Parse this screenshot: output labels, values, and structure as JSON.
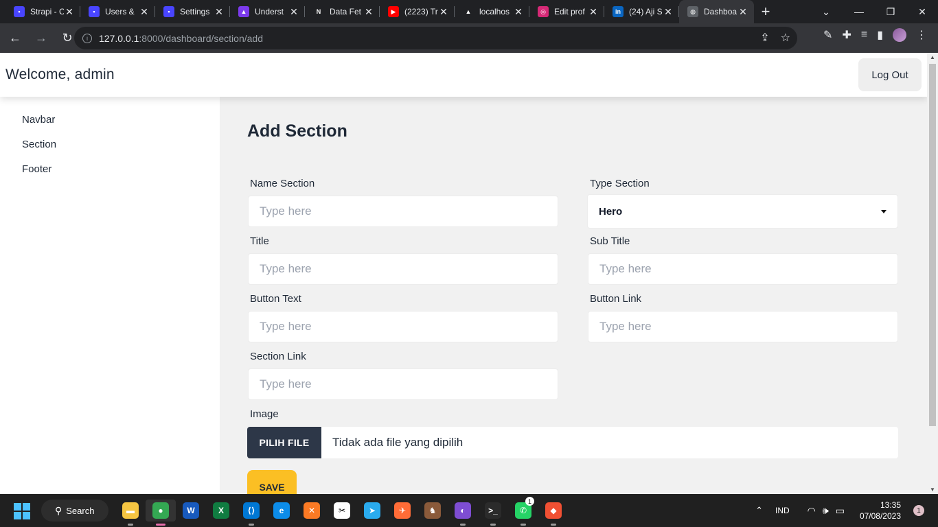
{
  "browser": {
    "tabs": [
      {
        "title": "Strapi - C",
        "favicon_color": "#4945ff",
        "favicon_glyph": "▪"
      },
      {
        "title": "Users &",
        "favicon_color": "#4945ff",
        "favicon_glyph": "▪"
      },
      {
        "title": "Settings",
        "favicon_color": "#4945ff",
        "favicon_glyph": "▪"
      },
      {
        "title": "Underst",
        "favicon_color": "#7c3aed",
        "favicon_glyph": "▲"
      },
      {
        "title": "Data Fet",
        "favicon_color": "#202124",
        "favicon_glyph": "N"
      },
      {
        "title": "(2223) Tr",
        "favicon_color": "#ff0000",
        "favicon_glyph": "▶"
      },
      {
        "title": "localhos",
        "favicon_color": "#202124",
        "favicon_glyph": "▲"
      },
      {
        "title": "Edit prof",
        "favicon_color": "#d62976",
        "favicon_glyph": "◎"
      },
      {
        "title": "(24) Aji S",
        "favicon_color": "#0a66c2",
        "favicon_glyph": "in"
      },
      {
        "title": "Dashboa",
        "favicon_color": "#5f6368",
        "favicon_glyph": "◍"
      }
    ],
    "new_tab_label": "+",
    "url_host": "127.0.0.1",
    "url_path": ":8000/dashboard/section/add"
  },
  "header": {
    "welcome": "Welcome, admin",
    "logout_label": "Log Out"
  },
  "sidebar": {
    "items": [
      {
        "label": "Navbar"
      },
      {
        "label": "Section"
      },
      {
        "label": "Footer"
      }
    ]
  },
  "form": {
    "title": "Add Section",
    "name_section": {
      "label": "Name Section",
      "placeholder": "Type here"
    },
    "type_section": {
      "label": "Type Section",
      "value": "Hero"
    },
    "title_field": {
      "label": "Title",
      "placeholder": "Type here"
    },
    "sub_title": {
      "label": "Sub Title",
      "placeholder": "Type here"
    },
    "button_text": {
      "label": "Button Text",
      "placeholder": "Type here"
    },
    "button_link": {
      "label": "Button Link",
      "placeholder": "Type here"
    },
    "section_link": {
      "label": "Section Link",
      "placeholder": "Type here"
    },
    "image": {
      "label": "Image",
      "button_label": "PILIH FILE",
      "file_status": "Tidak ada file yang dipilih"
    },
    "save_label": "SAVE"
  },
  "taskbar": {
    "search_label": "Search",
    "apps": [
      {
        "name": "file-explorer",
        "color": "#f5c542",
        "glyph": "▬"
      },
      {
        "name": "chrome",
        "color": "#34a853",
        "glyph": "●"
      },
      {
        "name": "word",
        "color": "#185abd",
        "glyph": "W"
      },
      {
        "name": "excel",
        "color": "#107c41",
        "glyph": "X"
      },
      {
        "name": "vscode",
        "color": "#0078d4",
        "glyph": "⟨⟩"
      },
      {
        "name": "edge",
        "color": "#0c8ce9",
        "glyph": "e"
      },
      {
        "name": "xampp",
        "color": "#fb7a24",
        "glyph": "✕"
      },
      {
        "name": "capcut",
        "color": "#ffffff",
        "glyph": "✂"
      },
      {
        "name": "telegram",
        "color": "#2aabee",
        "glyph": "➤"
      },
      {
        "name": "postman",
        "color": "#ff6c37",
        "glyph": "✈"
      },
      {
        "name": "game",
        "color": "#8a5a3a",
        "glyph": "♞"
      },
      {
        "name": "tor",
        "color": "#7e4dd2",
        "glyph": "◐"
      },
      {
        "name": "terminal",
        "color": "#2b2b2b",
        "glyph": ">_"
      },
      {
        "name": "whatsapp",
        "color": "#25d366",
        "glyph": "✆"
      },
      {
        "name": "git",
        "color": "#f05033",
        "glyph": "◆"
      }
    ],
    "whatsapp_badge": "1",
    "language": "IND",
    "time": "13:35",
    "date": "07/08/2023",
    "notification_count": "1"
  }
}
